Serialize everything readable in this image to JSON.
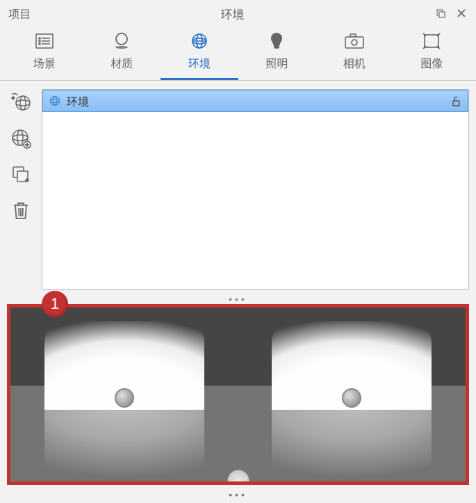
{
  "titlebar": {
    "project_label": "项目",
    "title": "环境"
  },
  "tabs": [
    {
      "id": "scene",
      "label": "场景"
    },
    {
      "id": "material",
      "label": "材质"
    },
    {
      "id": "environment",
      "label": "环境",
      "active": true
    },
    {
      "id": "lighting",
      "label": "照明"
    },
    {
      "id": "camera",
      "label": "相机"
    },
    {
      "id": "image",
      "label": "图像"
    }
  ],
  "list": {
    "items": [
      {
        "label": "环境"
      }
    ]
  },
  "callout": {
    "number": "1"
  },
  "dots": "•••"
}
